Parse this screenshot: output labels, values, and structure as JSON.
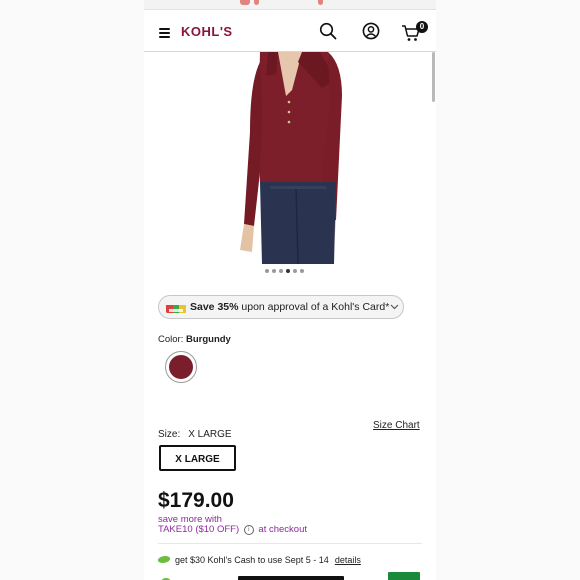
{
  "header": {
    "logo": "KOHL'S",
    "cart_count": "0",
    "icons": [
      "hamburger-menu-icon",
      "search-icon",
      "account-icon",
      "cart-icon"
    ]
  },
  "product": {
    "image_alt": "Burgundy ribbed v-neck polo sweater",
    "carousel_total": 6,
    "carousel_active": 4
  },
  "promo": {
    "save_bold": "Save 35%",
    "save_rest": " upon approval of a Kohl's Card*"
  },
  "color": {
    "label": "Color: ",
    "value": "Burgundy",
    "swatch_hex": "#7a1e2c"
  },
  "size": {
    "label": "Size:",
    "value": "X LARGE",
    "chart_link": "Size Chart",
    "selected_option": "X LARGE"
  },
  "price": {
    "amount": "$179.00",
    "save_more": "save more with",
    "code": "TAKE10 ($10 OFF)",
    "at_checkout": "at checkout"
  },
  "kohls_cash": {
    "text": "get $30 Kohl's Cash to use Sept 5 - 14",
    "details": "details"
  },
  "colors": {
    "brand": "#8a1538",
    "promo_text": "#8e2a9e",
    "kcash_green": "#6abf3f"
  }
}
